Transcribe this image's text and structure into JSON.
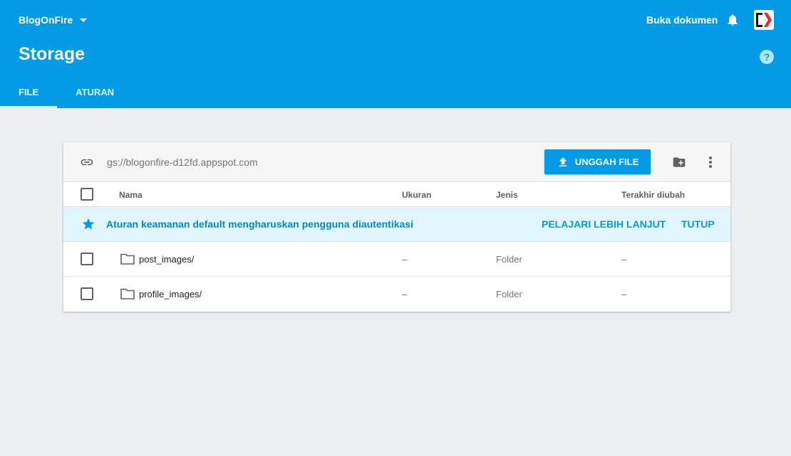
{
  "header": {
    "project_name": "BlogOnFire",
    "docs_link": "Buka dokumen",
    "page_title": "Storage",
    "help_glyph": "?",
    "tabs": [
      {
        "label": "FILE",
        "active": true
      },
      {
        "label": "ATURAN",
        "active": false
      }
    ]
  },
  "toolbar": {
    "bucket_url": "gs://blogonfire-d12fd.appspot.com",
    "upload_label": "UNGGAH FILE"
  },
  "table": {
    "columns": [
      "Nama",
      "Ukuran",
      "Jenis",
      "Terakhir diubah"
    ]
  },
  "notice": {
    "text": "Aturan keamanan default mengharuskan pengguna diautentikasi",
    "learn_more": "PELAJARI LEBIH LANJUT",
    "close": "TUTUP"
  },
  "rows": [
    {
      "name": "post_images/",
      "size": "–",
      "type": "Folder",
      "modified": "–"
    },
    {
      "name": "profile_images/",
      "size": "–",
      "type": "Folder",
      "modified": "–"
    }
  ],
  "colors": {
    "brand_blue": "#039be5",
    "notice_bg": "#e1f5fe",
    "page_bg": "#eceff1"
  }
}
